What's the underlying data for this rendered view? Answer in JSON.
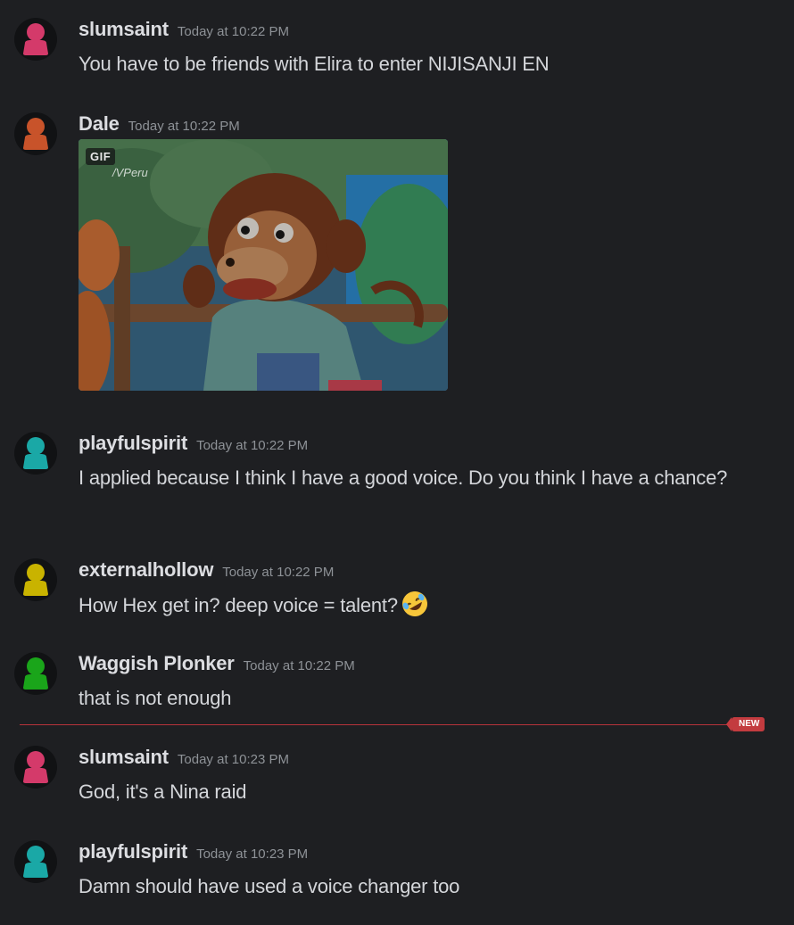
{
  "colors": {
    "background": "#1e1f22",
    "new_divider": "#b8333b",
    "avatar_pink": "#d43a6a",
    "avatar_orange": "#c8532a",
    "avatar_teal": "#1aa8a6",
    "avatar_yellow": "#c9b300",
    "avatar_green": "#1aa51a"
  },
  "messages": [
    {
      "username": "slumsaint",
      "timestamp": "Today at 10:22 PM",
      "text": "You have to be friends with Elira to enter NIJISANJI EN",
      "avatar_color": "#d43a6a"
    },
    {
      "username": "Dale",
      "timestamp": "Today at 10:22 PM",
      "attachment": {
        "type": "gif",
        "badge": "GIF",
        "watermark": "/VPeru",
        "subject": "puppet monkey glancing sideways"
      },
      "avatar_color": "#c8532a"
    },
    {
      "username": "playfulspirit",
      "timestamp": "Today at 10:22 PM",
      "text": "I applied because I think I have a good voice. Do you think I have a chance?",
      "avatar_color": "#1aa8a6"
    },
    {
      "username": "externalhollow",
      "timestamp": "Today at 10:22 PM",
      "text": "How Hex get in? deep voice = talent?",
      "emoji": "rolling-on-floor-laughing-emoji",
      "avatar_color": "#c9b300"
    },
    {
      "username": "Waggish Plonker",
      "timestamp": "Today at 10:22 PM",
      "text": "that is not enough",
      "avatar_color": "#1aa51a"
    },
    {
      "username": "slumsaint",
      "timestamp": "Today at 10:23 PM",
      "text": "God, it's a Nina raid",
      "avatar_color": "#d43a6a"
    },
    {
      "username": "playfulspirit",
      "timestamp": "Today at 10:23 PM",
      "text": "Damn should have used a voice changer too",
      "avatar_color": "#1aa8a6"
    }
  ],
  "new_divider": {
    "label": "NEW"
  }
}
